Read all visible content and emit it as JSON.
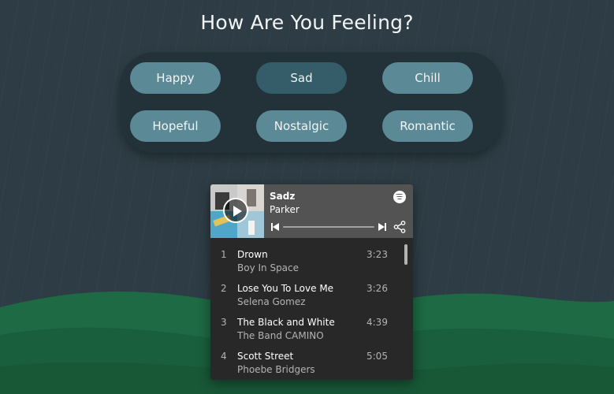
{
  "page": {
    "title": "How Are You Feeling?"
  },
  "moods": [
    {
      "label": "Happy",
      "active": false
    },
    {
      "label": "Sad",
      "active": true
    },
    {
      "label": "Chill",
      "active": false
    },
    {
      "label": "Hopeful",
      "active": false
    },
    {
      "label": "Nostalgic",
      "active": false
    },
    {
      "label": "Romantic",
      "active": false
    }
  ],
  "player": {
    "playlist_title": "Sadz",
    "owner": "Parker",
    "tracks": [
      {
        "number": "1",
        "name": "Drown",
        "artist": "Boy In Space",
        "duration": "3:23"
      },
      {
        "number": "2",
        "name": "Lose You To Love Me",
        "artist": "Selena Gomez",
        "duration": "3:26"
      },
      {
        "number": "3",
        "name": "The Black and White",
        "artist": "The Band CAMINO",
        "duration": "4:39"
      },
      {
        "number": "4",
        "name": "Scott Street",
        "artist": "Phoebe Bridgers",
        "duration": "5:05"
      }
    ]
  },
  "icons": [
    "play-icon",
    "spotify-logo-icon",
    "previous-track-icon",
    "next-track-icon",
    "share-icon"
  ],
  "colors": {
    "background": "#2e3d45",
    "panel": "#233238",
    "mood_button": "#5b8a96",
    "mood_button_active": "#345c69",
    "hills": "#1f6b45",
    "player_header": "#535353",
    "player_body": "#282828"
  }
}
